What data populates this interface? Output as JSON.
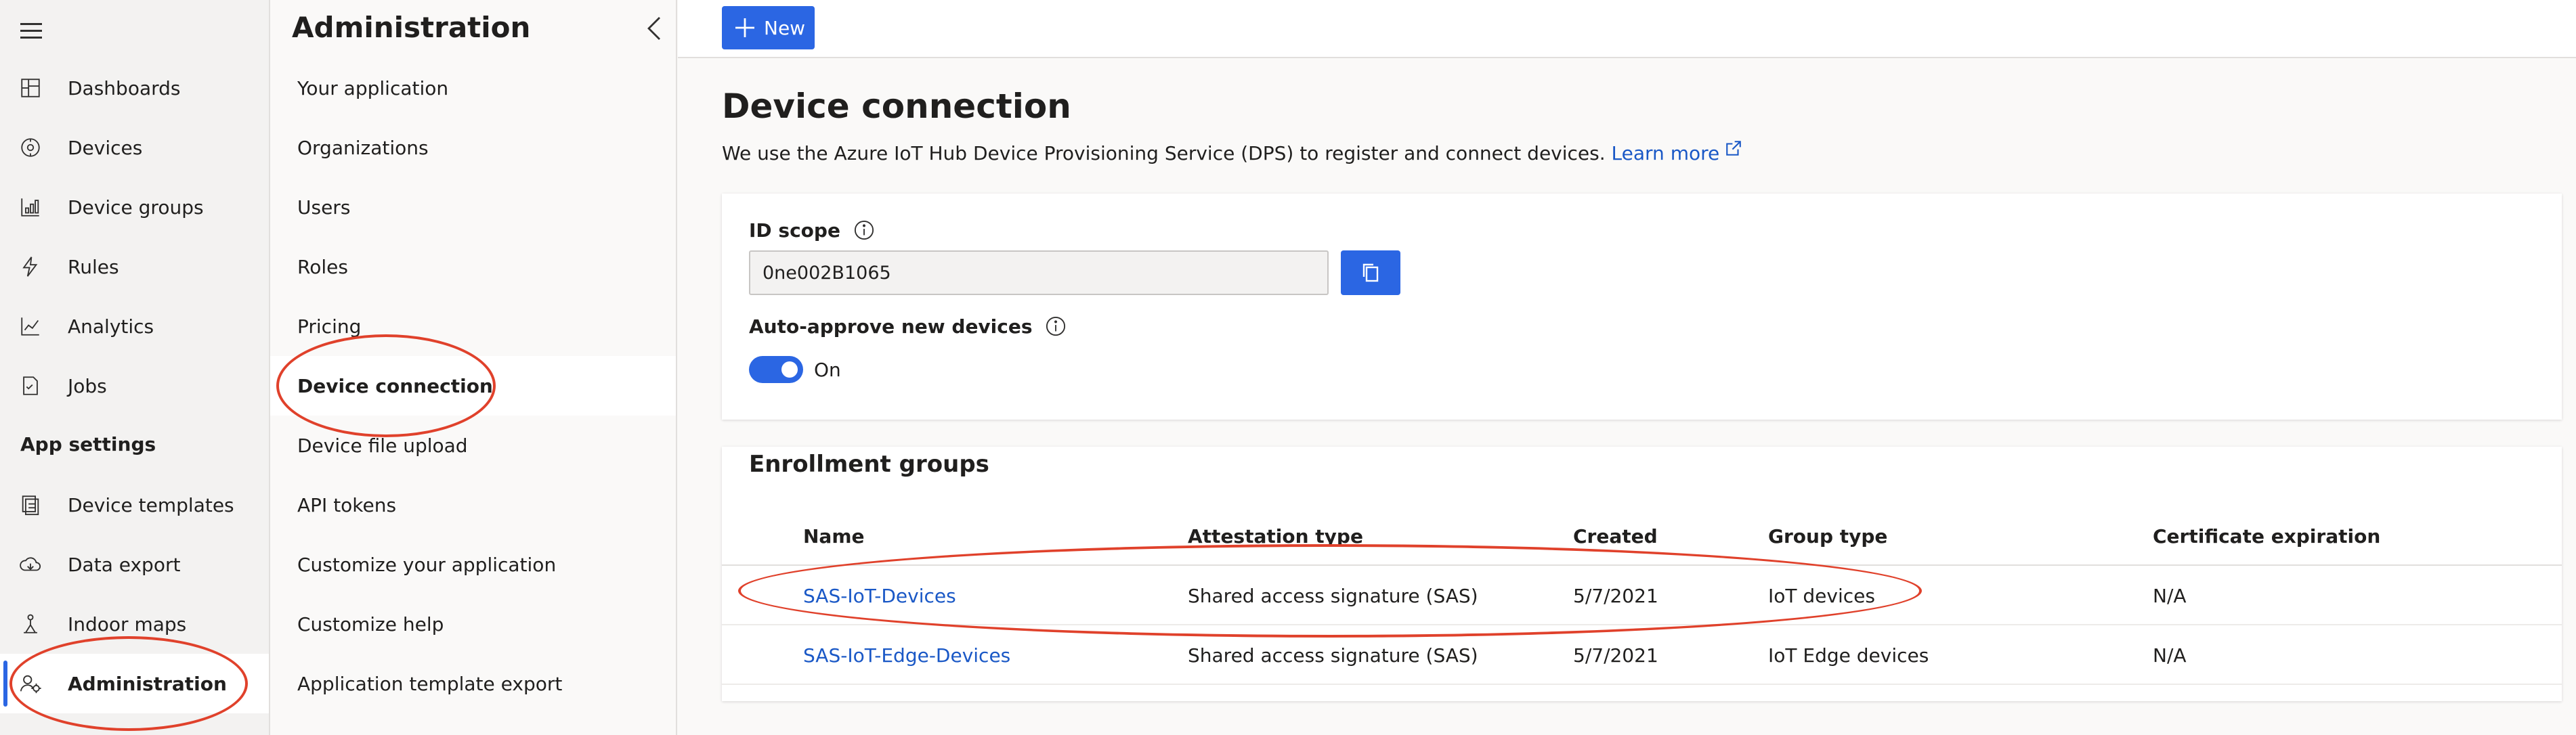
{
  "nav": {
    "items": [
      {
        "label": "Dashboards",
        "icon": "dashboard-icon"
      },
      {
        "label": "Devices",
        "icon": "devices-icon"
      },
      {
        "label": "Device groups",
        "icon": "device-groups-icon"
      },
      {
        "label": "Rules",
        "icon": "rules-icon"
      },
      {
        "label": "Analytics",
        "icon": "analytics-icon"
      },
      {
        "label": "Jobs",
        "icon": "jobs-icon"
      }
    ],
    "section_title": "App settings",
    "settings_items": [
      {
        "label": "Device templates",
        "icon": "device-templates-icon"
      },
      {
        "label": "Data export",
        "icon": "data-export-icon"
      },
      {
        "label": "Indoor maps",
        "icon": "indoor-maps-icon"
      },
      {
        "label": "Administration",
        "icon": "administration-icon",
        "active": true
      }
    ]
  },
  "admin": {
    "title": "Administration",
    "items": [
      "Your application",
      "Organizations",
      "Users",
      "Roles",
      "Pricing",
      "Device connection",
      "Device file upload",
      "API tokens",
      "Customize your application",
      "Customize help",
      "Application template export"
    ],
    "active_index": 5
  },
  "toolbar": {
    "new_label": "New"
  },
  "page": {
    "title": "Device connection",
    "description": "We use the Azure IoT Hub Device Provisioning Service (DPS) to register and connect devices.",
    "learn_more": "Learn more"
  },
  "id_scope": {
    "label": "ID scope",
    "value": "0ne002B1065"
  },
  "auto_approve": {
    "label": "Auto-approve new devices",
    "state_label": "On",
    "enabled": true
  },
  "enrollment": {
    "title": "Enrollment groups",
    "columns": [
      "Name",
      "Attestation type",
      "Created",
      "Group type",
      "Certificate expiration"
    ],
    "rows": [
      [
        "SAS-IoT-Devices",
        "Shared access signature (SAS)",
        "5/7/2021",
        "IoT devices",
        "N/A"
      ],
      [
        "SAS-IoT-Edge-Devices",
        "Shared access signature (SAS)",
        "5/7/2021",
        "IoT Edge devices",
        "N/A"
      ]
    ]
  },
  "colors": {
    "accent": "#2b66e3",
    "link": "#1a58c6",
    "annotation": "#e0412b"
  }
}
